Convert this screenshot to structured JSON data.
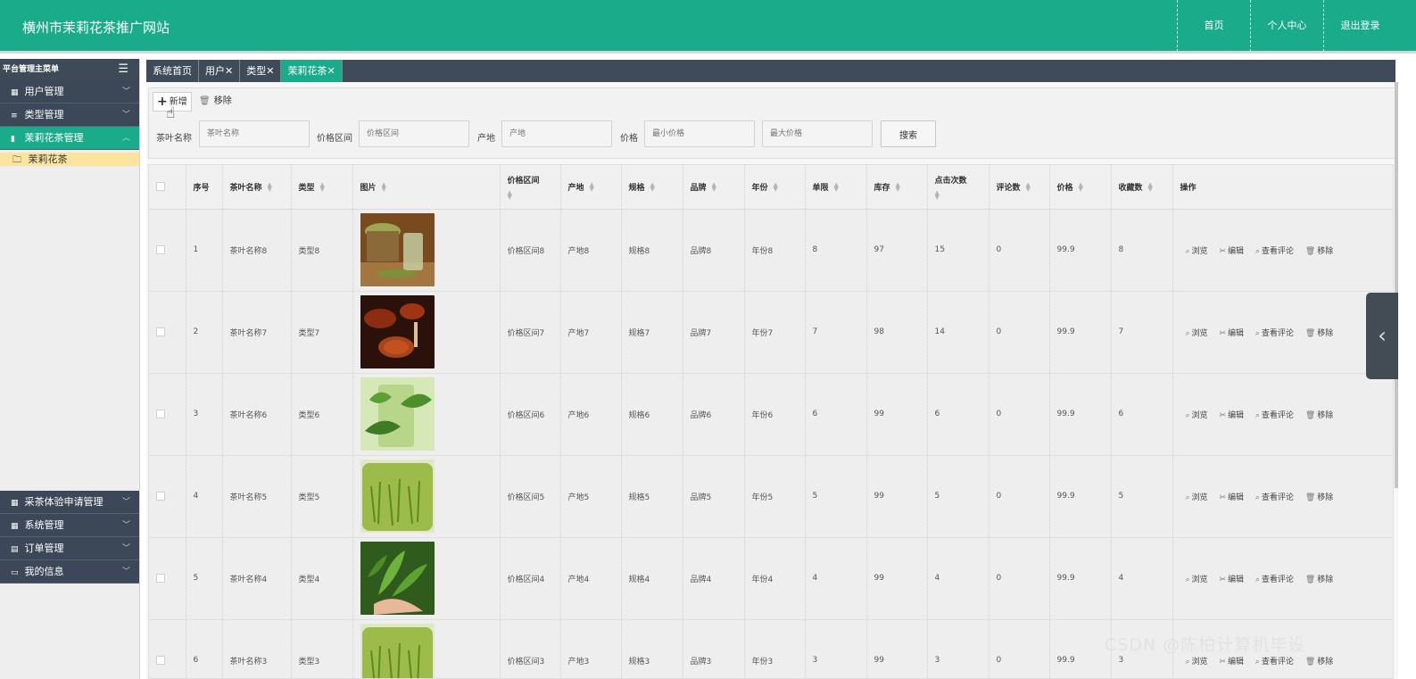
{
  "header": {
    "site_title": "横州市茉莉花茶推广网站",
    "nav": [
      {
        "label": "首页"
      },
      {
        "label": "个人中心"
      },
      {
        "label": "退出登录"
      }
    ]
  },
  "sidebar": {
    "title": "平台管理主菜单",
    "menus_top": [
      {
        "label": "用户管理",
        "icon": "grid-icon",
        "active": false
      },
      {
        "label": "类型管理",
        "icon": "list-icon",
        "active": false
      },
      {
        "label": "茉莉花茶管理",
        "icon": "book-icon",
        "active": true
      }
    ],
    "active_sub": {
      "label": "茉莉花茶",
      "icon": "folder-icon"
    },
    "menus_bottom": [
      {
        "label": "采茶体验申请管理",
        "icon": "grid-icon"
      },
      {
        "label": "系统管理",
        "icon": "grid-icon"
      },
      {
        "label": "订单管理",
        "icon": "table-icon"
      },
      {
        "label": "我的信息",
        "icon": "card-icon"
      }
    ]
  },
  "tabs": [
    {
      "label": "系统首页",
      "closable": false,
      "active": false
    },
    {
      "label": "用户",
      "closable": true,
      "active": false
    },
    {
      "label": "类型",
      "closable": true,
      "active": false
    },
    {
      "label": "茉莉花茶",
      "closable": true,
      "active": true
    }
  ],
  "toolbar": {
    "add_label": "新增",
    "delete_label": "移除",
    "search_label": "搜索",
    "filters": {
      "name_label": "茶叶名称",
      "name_placeholder": "茶叶名称",
      "price_range_label": "价格区间",
      "price_range_placeholder": "价格区间",
      "origin_label": "产地",
      "origin_placeholder": "产地",
      "price_label": "价格",
      "min_price_placeholder": "最小价格",
      "max_price_placeholder": "最大价格"
    }
  },
  "table": {
    "columns": [
      "序号",
      "茶叶名称",
      "类型",
      "图片",
      "价格区间",
      "产地",
      "规格",
      "品牌",
      "年份",
      "单限",
      "库存",
      "点击次数",
      "评论数",
      "价格",
      "收藏数",
      "操作"
    ],
    "actions": [
      "浏览",
      "编辑",
      "查看评论",
      "移除"
    ],
    "rows": [
      {
        "index": "1",
        "name": "茶叶名称8",
        "type": "类型8",
        "image": "tea-jar-glass",
        "price_range": "价格区间8",
        "origin": "产地8",
        "spec": "规格8",
        "brand": "品牌8",
        "year": "年份8",
        "limit": "8",
        "stock": "97",
        "clicks": "15",
        "comments": "0",
        "price": "99.9",
        "favorites": "8"
      },
      {
        "index": "2",
        "name": "茶叶名称7",
        "type": "类型7",
        "image": "red-tea-cups",
        "price_range": "价格区间7",
        "origin": "产地7",
        "spec": "规格7",
        "brand": "品牌7",
        "year": "年份7",
        "limit": "7",
        "stock": "98",
        "clicks": "14",
        "comments": "0",
        "price": "99.9",
        "favorites": "7"
      },
      {
        "index": "3",
        "name": "茶叶名称6",
        "type": "类型6",
        "image": "green-leaves-glass",
        "price_range": "价格区间6",
        "origin": "产地6",
        "spec": "规格6",
        "brand": "品牌6",
        "year": "年份6",
        "limit": "6",
        "stock": "99",
        "clicks": "6",
        "comments": "0",
        "price": "99.9",
        "favorites": "6"
      },
      {
        "index": "4",
        "name": "茶叶名称5",
        "type": "类型5",
        "image": "green-tea-glass",
        "price_range": "价格区间5",
        "origin": "产地5",
        "spec": "规格5",
        "brand": "品牌5",
        "year": "年份5",
        "limit": "5",
        "stock": "99",
        "clicks": "5",
        "comments": "0",
        "price": "99.9",
        "favorites": "5"
      },
      {
        "index": "5",
        "name": "茶叶名称4",
        "type": "类型4",
        "image": "tea-leaves-hand",
        "price_range": "价格区间4",
        "origin": "产地4",
        "spec": "规格4",
        "brand": "品牌4",
        "year": "年份4",
        "limit": "4",
        "stock": "99",
        "clicks": "4",
        "comments": "0",
        "price": "99.9",
        "favorites": "4"
      },
      {
        "index": "6",
        "name": "茶叶名称3",
        "type": "类型3",
        "image": "green-tea-glass",
        "price_range": "价格区间3",
        "origin": "产地3",
        "spec": "规格3",
        "brand": "品牌3",
        "year": "年份3",
        "limit": "3",
        "stock": "99",
        "clicks": "3",
        "comments": "0",
        "price": "99.9",
        "favorites": "3"
      }
    ]
  },
  "watermark": "CSDN @陈柏计算机毕设",
  "colors": {
    "primary": "#1aab8a",
    "dark_nav": "#3c4858",
    "active_sub": "#fbe3a0"
  }
}
